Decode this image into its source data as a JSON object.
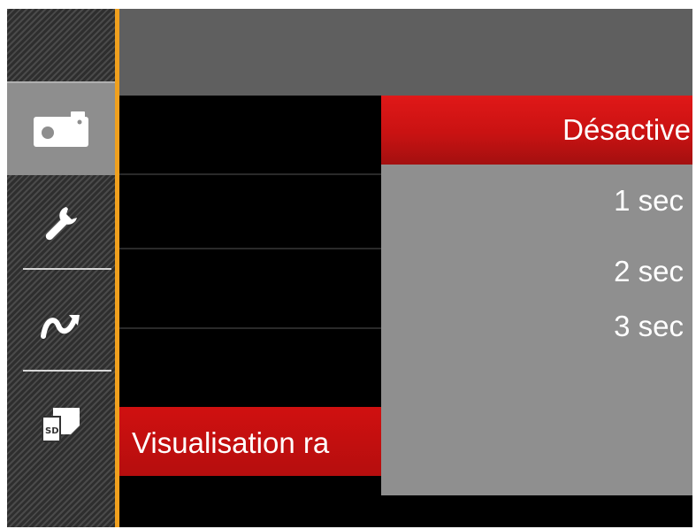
{
  "sidebar": {
    "items": [
      {
        "icon": "camera-icon",
        "active": true
      },
      {
        "icon": "wrench-icon",
        "active": false
      },
      {
        "icon": "connection-icon",
        "active": false
      },
      {
        "icon": "sd-card-icon",
        "active": false
      }
    ]
  },
  "menu": {
    "selected_label": "Visualisation ra"
  },
  "dropdown": {
    "options": [
      "Désactive",
      "1 sec",
      "2 sec",
      "3 sec"
    ],
    "selected_index": 0
  },
  "colors": {
    "accent": "#f0a01e",
    "highlight": "#d01010",
    "panel": "#8f8f8f",
    "header": "#5f5f5f"
  }
}
